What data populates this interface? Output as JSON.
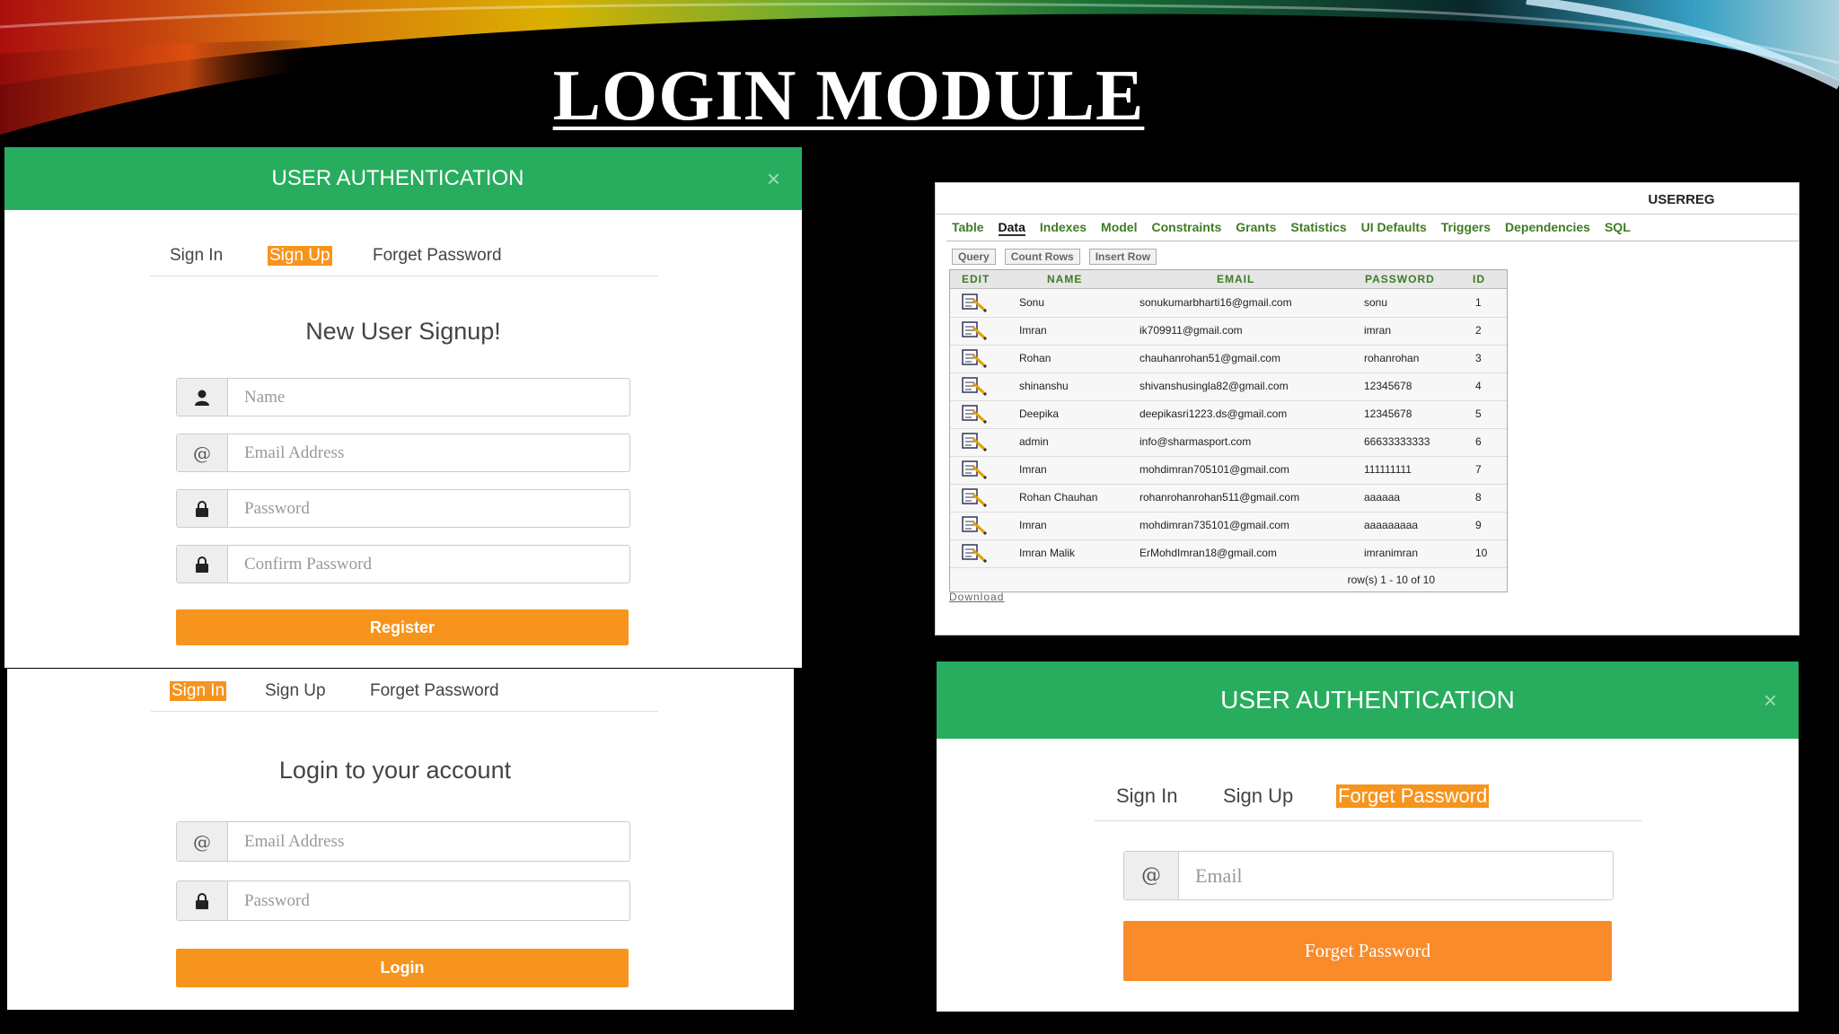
{
  "slide": {
    "title": "LOGIN MODULE"
  },
  "signup_panel": {
    "header_title": "USER AUTHENTICATION",
    "close_glyph": "×",
    "tabs": [
      "Sign In",
      "Sign Up",
      "Forget Password"
    ],
    "active_tab": "Sign Up",
    "heading": "New User Signup!",
    "fields": [
      {
        "icon": "user-icon",
        "placeholder": "Name"
      },
      {
        "icon": "at-icon",
        "placeholder": "Email Address"
      },
      {
        "icon": "lock-icon",
        "placeholder": "Password"
      },
      {
        "icon": "lock-icon",
        "placeholder": "Confirm Password"
      }
    ],
    "at_glyph": "@",
    "button_label": "Register"
  },
  "login_panel": {
    "tabs": [
      "Sign In",
      "Sign Up",
      "Forget Password"
    ],
    "active_tab": "Sign In",
    "heading": "Login to your account",
    "fields": [
      {
        "icon": "at-icon",
        "placeholder": "Email Address"
      },
      {
        "icon": "lock-icon",
        "placeholder": "Password"
      }
    ],
    "at_glyph": "@",
    "button_label": "Login"
  },
  "db_panel": {
    "table_name": "USERREG",
    "tabs": [
      "Table",
      "Data",
      "Indexes",
      "Model",
      "Constraints",
      "Grants",
      "Statistics",
      "UI Defaults",
      "Triggers",
      "Dependencies",
      "SQL"
    ],
    "active_tab": "Data",
    "buttons": [
      "Query",
      "Count Rows",
      "Insert Row"
    ],
    "columns": [
      "EDIT",
      "NAME",
      "EMAIL",
      "PASSWORD",
      "ID"
    ],
    "rows": [
      {
        "name": "Sonu",
        "email": "sonukumarbharti16@gmail.com",
        "password": "sonu",
        "id": "1"
      },
      {
        "name": "Imran",
        "email": "ik709911@gmail.com",
        "password": "imran",
        "id": "2"
      },
      {
        "name": "Rohan",
        "email": "chauhanrohan51@gmail.com",
        "password": "rohanrohan",
        "id": "3"
      },
      {
        "name": "shinanshu",
        "email": "shivanshusingla82@gmail.com",
        "password": "12345678",
        "id": "4"
      },
      {
        "name": "Deepika",
        "email": "deepikasri1223.ds@gmail.com",
        "password": "12345678",
        "id": "5"
      },
      {
        "name": "admin",
        "email": "info@sharmasport.com",
        "password": "66633333333",
        "id": "6"
      },
      {
        "name": "Imran",
        "email": "mohdimran705101@gmail.com",
        "password": "111111111",
        "id": "7"
      },
      {
        "name": "Rohan Chauhan",
        "email": "rohanrohanrohan511@gmail.com",
        "password": "aaaaaa",
        "id": "8"
      },
      {
        "name": "Imran",
        "email": "mohdimran735101@gmail.com",
        "password": "aaaaaaaaa",
        "id": "9"
      },
      {
        "name": "Imran Malik",
        "email": "ErMohdImran18@gmail.com",
        "password": "imranimran",
        "id": "10"
      }
    ],
    "row_count": "row(s) 1 - 10 of 10",
    "download_label": "Download"
  },
  "forget_panel": {
    "header_title": "USER AUTHENTICATION",
    "close_glyph": "×",
    "tabs": [
      "Sign In",
      "Sign Up",
      "Forget Password"
    ],
    "active_tab": "Forget Password",
    "field_placeholder": "Email",
    "at_glyph": "@",
    "button_label": "Forget Password"
  },
  "colors": {
    "header_green": "#28ad5e",
    "accent_orange": "#f7941d",
    "db_link_green": "#3f7b24"
  }
}
